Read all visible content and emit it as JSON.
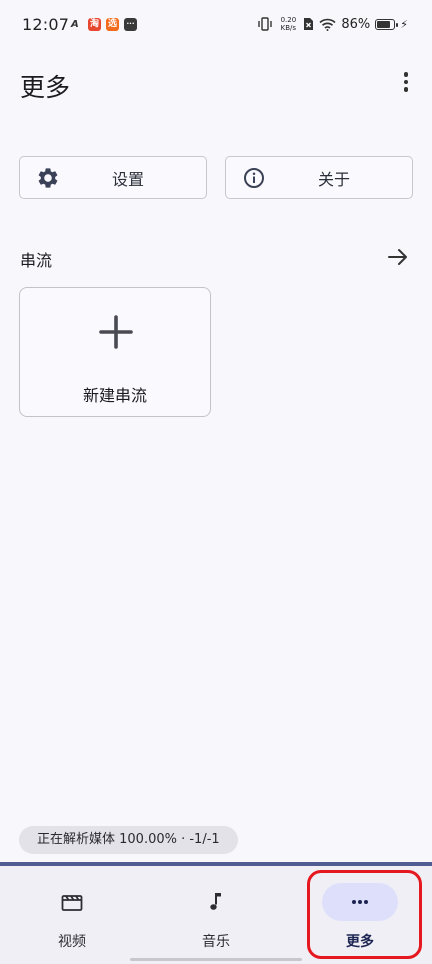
{
  "status_bar": {
    "time": "12:07",
    "notif_a": "A",
    "notif_app1": "淘",
    "notif_app2": "选",
    "notif_app3": "···",
    "net_speed_value": "0.20",
    "net_speed_unit": "KB/s",
    "battery_percent": "86%",
    "battery_level": 0.86
  },
  "app_bar": {
    "title": "更多"
  },
  "actions": {
    "settings_label": "设置",
    "about_label": "关于"
  },
  "streams_section": {
    "title": "串流",
    "new_stream_label": "新建串流"
  },
  "progress": {
    "text": "正在解析媒体 100.00% · -1/-1"
  },
  "bottom_nav": {
    "items": [
      {
        "label": "视频",
        "icon": "clapperboard-icon",
        "selected": false
      },
      {
        "label": "音乐",
        "icon": "music-note-icon",
        "selected": false
      },
      {
        "label": "更多",
        "icon": "more-horiz-icon",
        "selected": true
      }
    ]
  },
  "colors": {
    "accent": "#515d90",
    "selected_pill": "#dee0fb",
    "highlight": "#e5171f",
    "background": "#f8f7fc"
  }
}
